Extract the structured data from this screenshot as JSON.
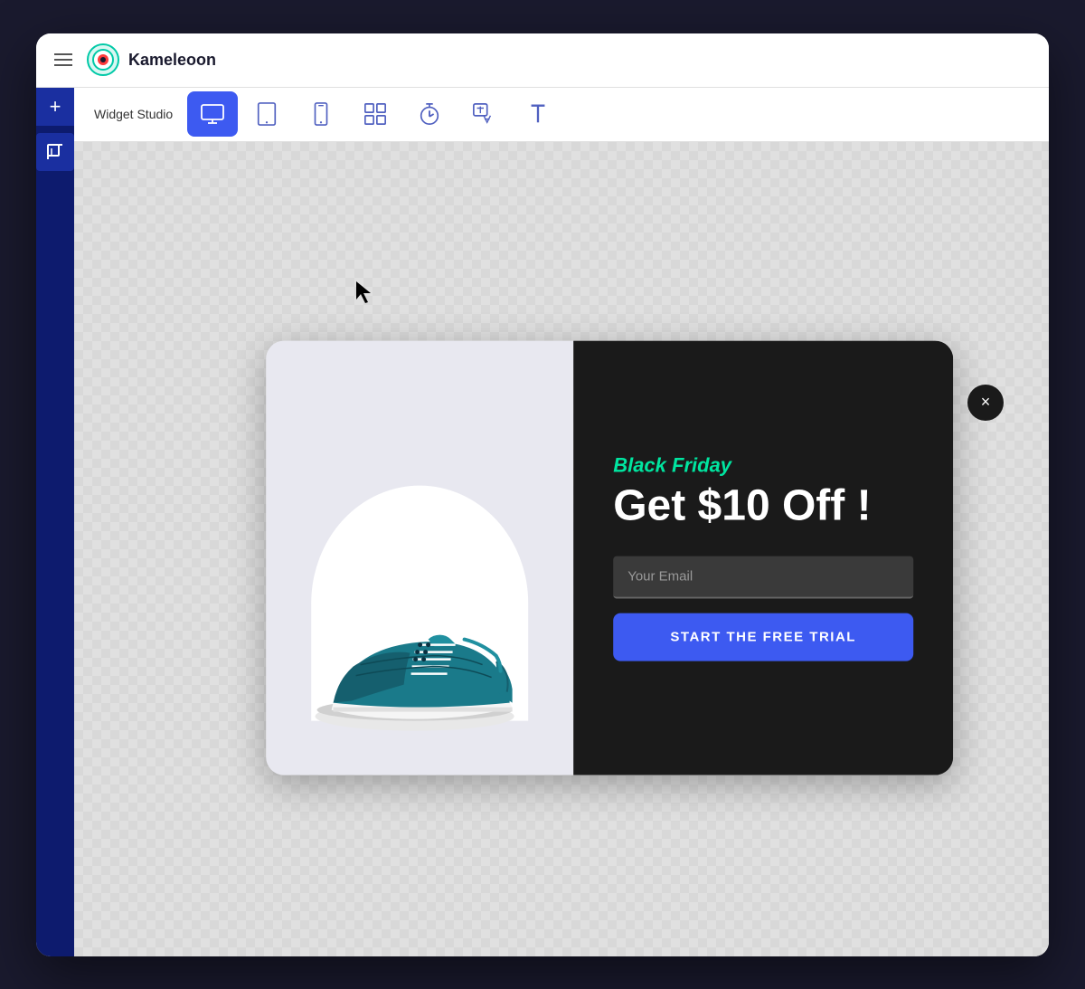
{
  "app": {
    "name": "Kameleoon",
    "title": "Widget Studio"
  },
  "toolbar": {
    "label": "Widget Studio",
    "devices": [
      {
        "id": "desktop",
        "label": "Desktop",
        "active": true
      },
      {
        "id": "tablet",
        "label": "Tablet",
        "active": false
      },
      {
        "id": "mobile",
        "label": "Mobile",
        "active": false
      },
      {
        "id": "ab-test",
        "label": "A/B Test",
        "active": false
      },
      {
        "id": "timer",
        "label": "Timer",
        "active": false
      },
      {
        "id": "translate",
        "label": "Translate",
        "active": false
      },
      {
        "id": "text",
        "label": "Text",
        "active": false
      }
    ]
  },
  "popup": {
    "badge": "Black Friday",
    "headline": "Get $10 Off !",
    "email_placeholder": "Your Email",
    "cta_label": "START THE FREE TRIAL",
    "close_label": "×"
  },
  "colors": {
    "accent_green": "#00e5a0",
    "accent_blue": "#3d5af1",
    "dark_bg": "#1a1a1a",
    "sidebar_bg": "#0d1b6e",
    "white": "#ffffff"
  }
}
